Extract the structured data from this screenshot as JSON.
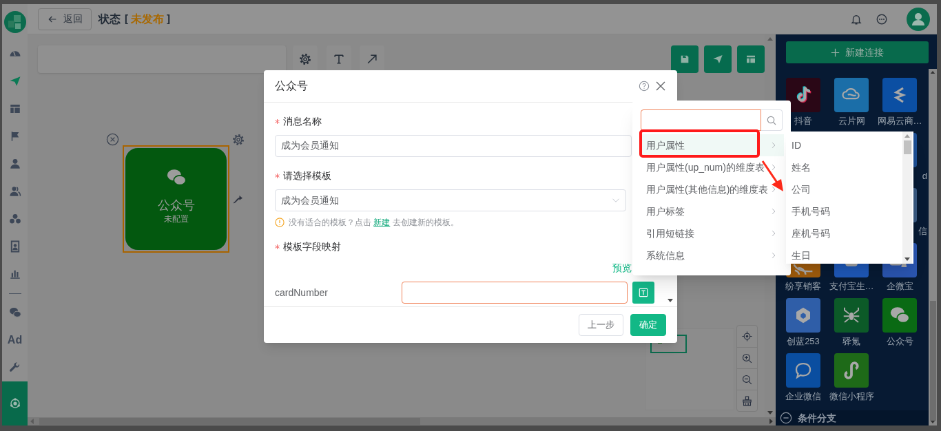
{
  "header": {
    "back_button": "返回",
    "title": "状态",
    "status": {
      "open": "[",
      "label": "未发布",
      "close": "]"
    }
  },
  "sidebar": {
    "items": [
      {
        "kind": "icon",
        "selected": false
      },
      {
        "kind": "icon",
        "selected": false
      },
      {
        "kind": "icon",
        "selected": false
      },
      {
        "kind": "icon",
        "selected": false
      },
      {
        "kind": "icon",
        "selected": false
      },
      {
        "kind": "icon",
        "selected": false
      },
      {
        "kind": "icon",
        "selected": false
      },
      {
        "kind": "icon",
        "selected": false
      },
      {
        "kind": "icon",
        "selected": false
      },
      {
        "kind": "divider"
      },
      {
        "kind": "icon",
        "selected": false
      },
      {
        "kind": "text",
        "label": "Ad",
        "selected": false
      },
      {
        "kind": "icon",
        "selected": false
      },
      {
        "kind": "icon",
        "selected": true
      }
    ]
  },
  "canvas": {
    "node": {
      "title": "公众号",
      "subtitle": "未配置",
      "selected": true
    }
  },
  "right_panel": {
    "new_button": "新建连接",
    "connectors": [
      {
        "label": "抖音",
        "color": "#2a0716"
      },
      {
        "label": "云片网",
        "color": "#1b6ea8"
      },
      {
        "label": "网易云商…",
        "color": "#0b4fa3"
      },
      {
        "kind": "partial",
        "label": "d",
        "color": "#1d4f94"
      },
      {
        "kind": "partial",
        "label": "信",
        "color": "#3a5a80"
      },
      {
        "label": "纷享销客",
        "color": "#a05c0c"
      },
      {
        "label": "支付宝生…",
        "color": "#1e58b8"
      },
      {
        "label": "企微宝",
        "color": "#2a55b0"
      },
      {
        "label": "创蓝253",
        "color": "#2f5ea8"
      },
      {
        "label": "驿氪",
        "color": "#0c5a28"
      },
      {
        "label": "公众号",
        "color": "#0a6a14"
      },
      {
        "label": "企业微信",
        "color": "#0a4ea0"
      },
      {
        "label": "微信小程序",
        "color": "#1e6a18"
      }
    ],
    "section": "条件分支"
  },
  "dialog": {
    "title": "公众号",
    "fields": [
      {
        "kind": "input",
        "label": "消息名称",
        "required": true,
        "value": "成为会员通知"
      },
      {
        "kind": "select",
        "label": "请选择模板",
        "required": true,
        "value": "成为会员通知"
      }
    ],
    "hint": {
      "before": "没有适合的模板？点击 ",
      "link": "新建",
      "after": " 去创建新的模板。"
    },
    "mapping": {
      "label": "模板字段映射",
      "required": true,
      "preview": "预览",
      "rows": [
        {
          "name": "cardNumber",
          "focused": true
        }
      ]
    },
    "buttons": [
      {
        "kind": "default",
        "label": "上一步"
      },
      {
        "kind": "primary",
        "label": "确定"
      }
    ]
  },
  "dropdown": {
    "items": [
      {
        "label": "用户属性",
        "selected": true
      },
      {
        "label": "用户属性(up_num)的维度表",
        "selected": false
      },
      {
        "label": "用户属性(其他信息)的维度表",
        "selected": false
      },
      {
        "label": "用户标签",
        "selected": false
      },
      {
        "label": "引用短链接",
        "selected": false
      },
      {
        "label": "系统信息",
        "selected": false
      }
    ],
    "submenu": {
      "items": [
        {
          "label": "ID"
        },
        {
          "label": "姓名"
        },
        {
          "label": "公司"
        },
        {
          "label": "手机号码"
        },
        {
          "label": "座机号码"
        },
        {
          "label": "生日"
        }
      ]
    }
  }
}
